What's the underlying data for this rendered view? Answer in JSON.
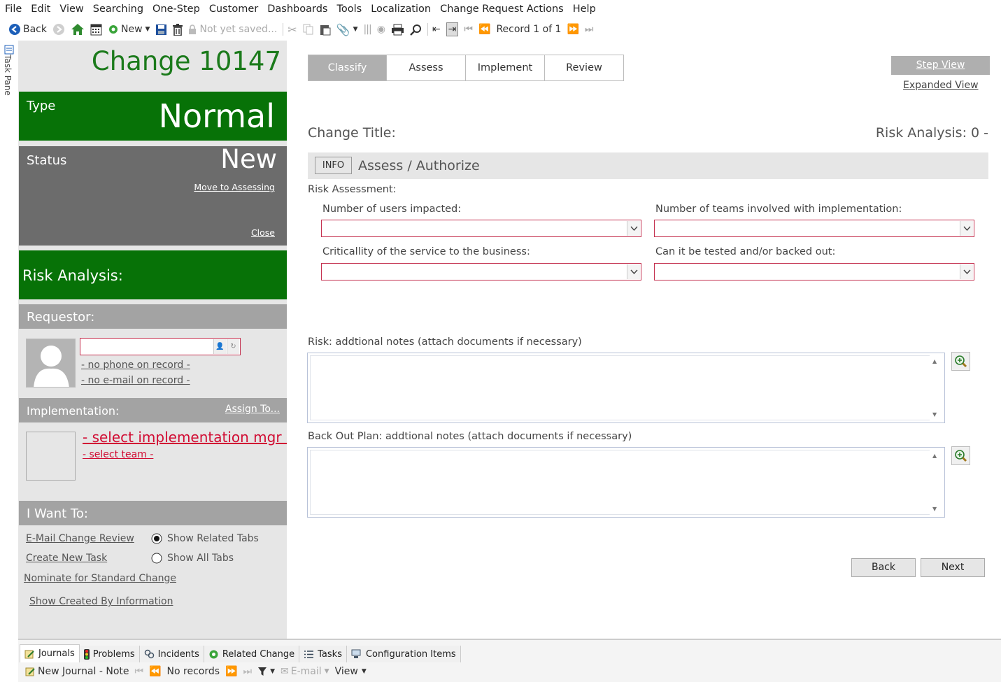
{
  "menu": [
    "File",
    "Edit",
    "View",
    "Searching",
    "One-Step",
    "Customer",
    "Dashboards",
    "Tools",
    "Localization",
    "Change Request Actions",
    "Help"
  ],
  "toolbar": {
    "back_label": "Back",
    "new_label": "New",
    "not_saved_label": "Not yet saved...",
    "record_label": "Record 1 of 1"
  },
  "taskpane_label": "Task Pane",
  "left": {
    "title": "Change 10147",
    "type_label": "Type",
    "type_value": "Normal",
    "status_label": "Status",
    "status_value": "New",
    "move_link": "Move to Assessing",
    "close_link": "Close",
    "risk_label": "Risk Analysis:",
    "requestor_header": "Requestor:",
    "requestor_phone": "- no phone on record -",
    "requestor_email": "- no e-mail on record -",
    "implementation_header": "Implementation:",
    "assign_to": "Assign To...",
    "impl_mgr": "- select implementation mgr -",
    "impl_team": "- select team -",
    "iwant_header": "I Want To:",
    "email_review": "E-Mail Change Review",
    "create_task": "Create New Task",
    "nominate": "Nominate for Standard Change",
    "show_created": "Show Created By Information",
    "radio_related": "Show Related Tabs",
    "radio_all": "Show All Tabs"
  },
  "main": {
    "tabs": [
      "Classify",
      "Assess",
      "Implement",
      "Review"
    ],
    "active_tab": "Classify",
    "step_view": "Step View",
    "expanded_view": "Expanded View",
    "change_title_label": "Change Title:",
    "risk_analysis_label": "Risk Analysis: 0 -",
    "info_button": "INFO",
    "section_title": "Assess / Authorize",
    "risk_assessment_label": "Risk Assessment:",
    "users_impacted_label": "Number of users impacted:",
    "teams_label": "Number of teams involved with implementation:",
    "criticality_label": "Criticallity of the service to the business:",
    "tested_label": "Can it be tested and/or backed out:",
    "risk_notes_label": "Risk: addtional notes (attach documents if necessary)",
    "backout_label": "Back Out Plan: addtional notes (attach documents if necessary)",
    "back_button": "Back",
    "next_button": "Next"
  },
  "bottom": {
    "tabs": [
      "Journals",
      "Problems",
      "Incidents",
      "Related Change",
      "Tasks",
      "Configuration Items"
    ],
    "new_journal": "New Journal - Note",
    "no_records": "No records",
    "email": "E-mail",
    "view": "View"
  },
  "colors": {
    "green": "#077207",
    "red": "#d10c33",
    "gray_panel": "#6c6c6c"
  }
}
